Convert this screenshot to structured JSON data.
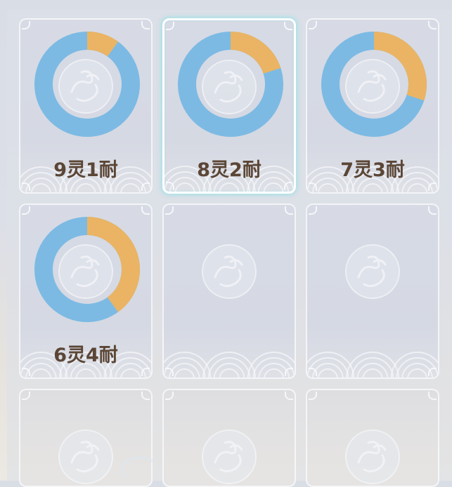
{
  "colors": {
    "ling": "#eab464",
    "nai": "#7cbae4",
    "label": "#5b4636",
    "selected_glow": "#a0e1e8"
  },
  "slots": [
    {
      "label": "9灵1耐",
      "ling": 1,
      "nai": 9,
      "selected": false
    },
    {
      "label": "8灵2耐",
      "ling": 2,
      "nai": 8,
      "selected": true
    },
    {
      "label": "7灵3耐",
      "ling": 3,
      "nai": 7,
      "selected": false
    },
    {
      "label": "6灵4耐",
      "ling": 4,
      "nai": 6,
      "selected": false
    },
    {
      "label": "",
      "empty": true
    },
    {
      "label": "",
      "empty": true
    },
    {
      "label": "",
      "empty": true
    },
    {
      "label": "",
      "empty": true
    },
    {
      "label": "",
      "empty": true
    }
  ]
}
